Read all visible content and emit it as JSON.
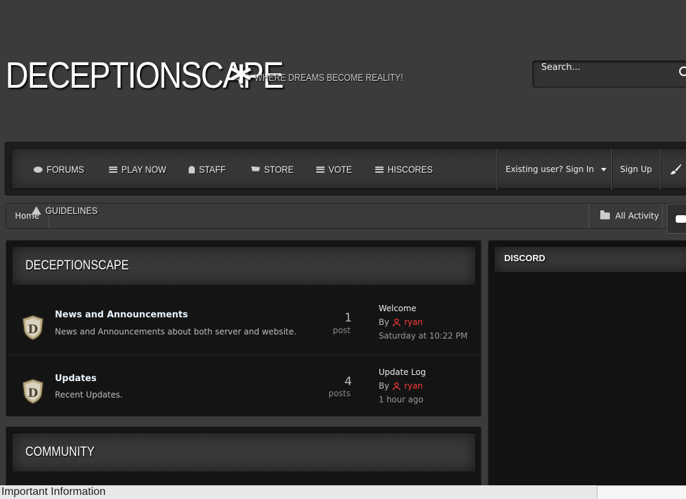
{
  "header": {
    "site_title": "DECEPTIONSCAPE",
    "asterisk": "*",
    "tagline": "WHERE DREAMS BECOME REALITY!",
    "search_placeholder": "Search..."
  },
  "nav": {
    "items": [
      {
        "label": "FORUMS",
        "icon": "chat-icon"
      },
      {
        "label": "PLAY NOW",
        "icon": "menu-icon"
      },
      {
        "label": "STAFF",
        "icon": "user-icon"
      },
      {
        "label": "STORE",
        "icon": "cart-icon"
      },
      {
        "label": "VOTE",
        "icon": "menu-icon"
      },
      {
        "label": "HISCORES",
        "icon": "menu-icon"
      }
    ],
    "second_row": {
      "label": "GUIDELINES",
      "icon": "warning-icon"
    },
    "sign_in": "Existing user? Sign In",
    "sign_up": "Sign Up"
  },
  "breadcrumb": {
    "home": "Home",
    "all_activity": "All Activity"
  },
  "categories": [
    {
      "title": "DECEPTIONSCAPE",
      "forums": [
        {
          "name": "News and Announcements",
          "description": "News and Announcements about both server and website.",
          "count": "1",
          "count_label": "post",
          "last_title": "Welcome",
          "last_by": "By",
          "last_user": "ryan",
          "last_date": "Saturday at 10:22 PM"
        },
        {
          "name": "Updates",
          "description": "Recent Updates.",
          "count": "4",
          "count_label": "posts",
          "last_title": "Update Log",
          "last_by": "By",
          "last_user": "ryan",
          "last_date": "1 hour ago"
        }
      ]
    },
    {
      "title": "COMMUNITY"
    }
  ],
  "sidebar": {
    "discord_title": "DISCORD"
  },
  "footer": {
    "important_information": "Important Information"
  },
  "colors": {
    "background": "#3b3b3b",
    "panel": "#141414",
    "username": "#ff3b3b",
    "forum_name": "#e9f4ff"
  }
}
